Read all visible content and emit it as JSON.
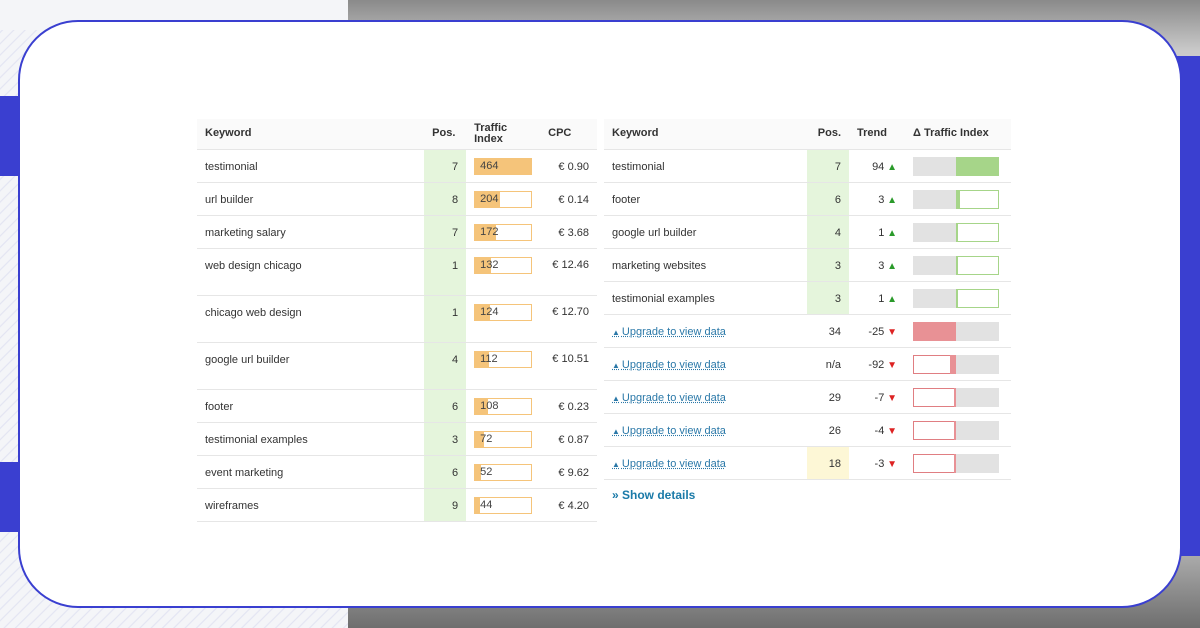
{
  "left_table": {
    "headers": {
      "keyword": "Keyword",
      "pos": "Pos.",
      "traffic": "Traffic Index",
      "cpc": "CPC"
    },
    "rows": [
      {
        "keyword": "testimonial",
        "pos": "7",
        "traffic": "464",
        "traffic_fill": 1.0,
        "cpc": "€ 0.90"
      },
      {
        "keyword": "url builder",
        "pos": "8",
        "traffic": "204",
        "traffic_fill": 0.44,
        "cpc": "€ 0.14"
      },
      {
        "keyword": "marketing salary",
        "pos": "7",
        "traffic": "172",
        "traffic_fill": 0.37,
        "cpc": "€ 3.68"
      },
      {
        "keyword": "web design chicago",
        "pos": "1",
        "traffic": "132",
        "traffic_fill": 0.28,
        "cpc": "€ 12.46"
      },
      {
        "keyword": "chicago web design",
        "pos": "1",
        "traffic": "124",
        "traffic_fill": 0.27,
        "cpc": "€ 12.70"
      },
      {
        "keyword": "google url builder",
        "pos": "4",
        "traffic": "112",
        "traffic_fill": 0.24,
        "cpc": "€ 10.51"
      },
      {
        "keyword": "footer",
        "pos": "6",
        "traffic": "108",
        "traffic_fill": 0.23,
        "cpc": "€ 0.23"
      },
      {
        "keyword": "testimonial examples",
        "pos": "3",
        "traffic": "72",
        "traffic_fill": 0.16,
        "cpc": "€ 0.87"
      },
      {
        "keyword": "event marketing",
        "pos": "6",
        "traffic": "52",
        "traffic_fill": 0.11,
        "cpc": "€ 9.62"
      },
      {
        "keyword": "wireframes",
        "pos": "9",
        "traffic": "44",
        "traffic_fill": 0.09,
        "cpc": "€ 4.20"
      }
    ]
  },
  "right_table": {
    "headers": {
      "keyword": "Keyword",
      "pos": "Pos.",
      "trend": "Trend",
      "delta": "Δ Traffic Index"
    },
    "rows": [
      {
        "keyword": "testimonial",
        "upgrade": false,
        "pos": "7",
        "trend": "94",
        "dir": "up",
        "delta": 1.0
      },
      {
        "keyword": "footer",
        "upgrade": false,
        "pos": "6",
        "trend": "3",
        "dir": "up",
        "delta": 0.1
      },
      {
        "keyword": "google url builder",
        "upgrade": false,
        "pos": "4",
        "trend": "1",
        "dir": "up",
        "delta": 0.05
      },
      {
        "keyword": "marketing websites",
        "upgrade": false,
        "pos": "3",
        "trend": "3",
        "dir": "up",
        "delta": 0.02
      },
      {
        "keyword": "testimonial examples",
        "upgrade": false,
        "pos": "3",
        "trend": "1",
        "dir": "up",
        "delta": 0.02
      },
      {
        "keyword": "Upgrade to view data",
        "upgrade": true,
        "pos": "34",
        "trend": "-25",
        "dir": "down",
        "delta": -1.0
      },
      {
        "keyword": "Upgrade to view data",
        "upgrade": true,
        "pos": "n/a",
        "trend": "-92",
        "dir": "down",
        "delta": -0.14
      },
      {
        "keyword": "Upgrade to view data",
        "upgrade": true,
        "pos": "29",
        "trend": "-7",
        "dir": "down",
        "delta": -0.02
      },
      {
        "keyword": "Upgrade to view data",
        "upgrade": true,
        "pos": "26",
        "trend": "-4",
        "dir": "down",
        "delta": -0.02
      },
      {
        "keyword": "Upgrade to view data",
        "upgrade": true,
        "pos": "18",
        "pos_yellow": true,
        "trend": "-3",
        "dir": "down",
        "delta": -0.02
      }
    ],
    "show_details": "» Show details"
  },
  "icons": {
    "up": "arrow-up-icon",
    "down": "arrow-down-icon",
    "upgrade": "upgrade-arrow-icon"
  },
  "colors": {
    "pos_bg": "#e5f5dc",
    "traffic_bar": "#f5c47a",
    "delta_pos": "#a6d589",
    "delta_neg": "#e89195",
    "link": "#2a78a8",
    "accent": "#3a3fd0"
  }
}
